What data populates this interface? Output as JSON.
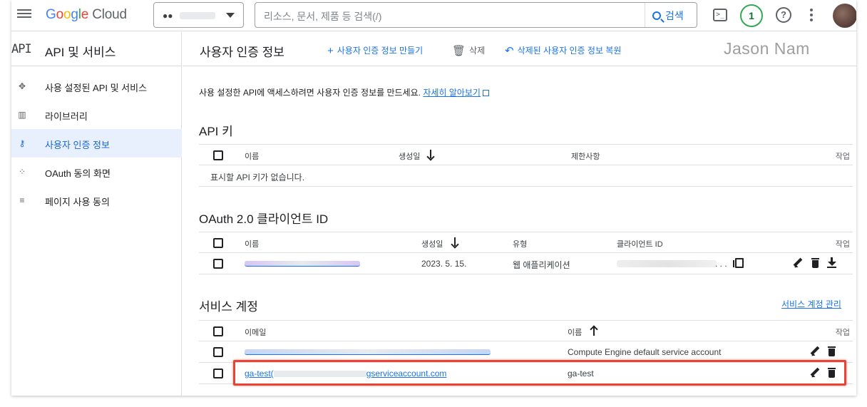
{
  "topbar": {
    "logo_google": "Google",
    "logo_cloud": "Cloud",
    "search_placeholder": "리소스, 문서, 제품 등 검색(/)",
    "search_button": "검색",
    "notifications_count": "1",
    "help_glyph": "?",
    "terminal_glyph": ">_"
  },
  "nav": {
    "mark": "API",
    "title": "API 및 서비스",
    "items": [
      {
        "label": "사용 설정된 API 및 서비스",
        "icon": "enabled-apis-icon",
        "active": false
      },
      {
        "label": "라이브러리",
        "icon": "library-icon",
        "active": false
      },
      {
        "label": "사용자 인증 정보",
        "icon": "key-icon",
        "active": true
      },
      {
        "label": "OAuth 동의 화면",
        "icon": "oauth-consent-icon",
        "active": false
      },
      {
        "label": "페이지 사용 동의",
        "icon": "page-usage-agreement-icon",
        "active": false
      }
    ]
  },
  "header": {
    "title": "사용자 인증 정보",
    "create_label": "사용자 인증 정보 만들기",
    "delete_label": "삭제",
    "restore_label": "삭제된 사용자 인증 정보 복원",
    "watermark": "Jason Nam"
  },
  "intro": {
    "text": "사용 설정한 API에 액세스하려면 사용자 인증 정보를 만드세요. ",
    "link": "자세히 알아보기"
  },
  "api_keys": {
    "title": "API 키",
    "columns": [
      "이름",
      "생성일",
      "제한사항",
      "작업"
    ],
    "empty": "표시할 API 키가 없습니다."
  },
  "oauth": {
    "title": "OAuth 2.0 클라이언트 ID",
    "columns": [
      "이름",
      "생성일",
      "유형",
      "클라이언트 ID",
      "작업"
    ],
    "rows": [
      {
        "created": "2023. 5. 15.",
        "type": "웹 애플리케이션",
        "client_id_suffix": ". . ."
      }
    ]
  },
  "service_accounts": {
    "title": "서비스 계정",
    "manage_link": "서비스 계정 관리",
    "columns": [
      "이메일",
      "이름",
      "작업"
    ],
    "rows": [
      {
        "email": "",
        "name": "Compute Engine default service account"
      },
      {
        "email_prefix": "ga-test(",
        "email_suffix": "gserviceaccount.com",
        "name": "ga-test"
      }
    ]
  },
  "colors": {
    "accent": "#1a73e8",
    "highlight": "#ea4335",
    "active_bg": "#e8f0fe"
  }
}
